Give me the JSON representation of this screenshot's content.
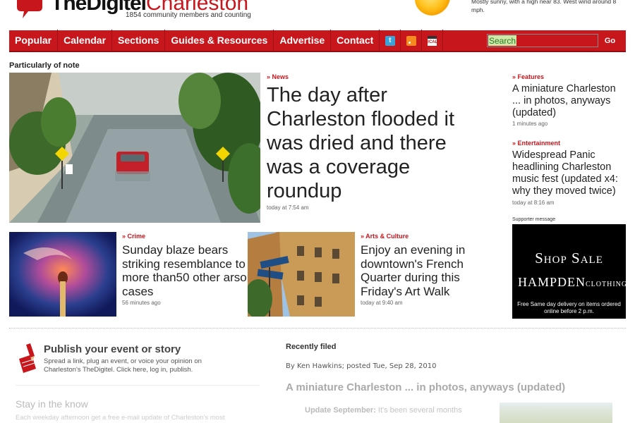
{
  "header": {
    "logo_part1": "TheDigitel",
    "logo_part2": "Charleston",
    "tagline": "1854 community members and counting",
    "weather": "Mostly sunny, with a high near 83. West wind around 8 mph.",
    "accent_color": "#c8161d"
  },
  "nav": {
    "items": [
      "Popular",
      "Calendar",
      "Sections",
      "Guides & Resources",
      "Advertise",
      "Contact"
    ],
    "icons": [
      "twitter-icon",
      "rss-icon",
      "ical-icon"
    ],
    "search_placeholder": "Search",
    "go_label": "Go"
  },
  "section_label": "Particularly of note",
  "main_story": {
    "category": "News",
    "headline": "The day after Charleston flooded it was dried and there was a coverage roundup",
    "time": "today at 7:54 am"
  },
  "stories": [
    {
      "category": "Crime",
      "headline": "Sunday blaze bears striking resemblance to more than50 other arson cases",
      "time": "56 minutes ago"
    },
    {
      "category": "Arts & Culture",
      "headline": "Enjoy an evening in downtown's French Quarter during this Friday's Art Walk",
      "time": "today at 9:40 am"
    }
  ],
  "sidebar": {
    "items": [
      {
        "category": "Features",
        "headline": "A miniature Charleston ... in photos, anyways (updated)",
        "time": "1 minutes ago"
      },
      {
        "category": "Entertainment",
        "headline": "Widespread Panic headlining Charleston music fest (updated x4: why they moved twice)",
        "time": "today at 8:16 am"
      }
    ],
    "supporter_label": "Supporter message",
    "ad": {
      "line1": "Shop Sale",
      "line2": "HAMPDEN",
      "line2_small": "CLOTHING",
      "line3": "Free Same day delivery on items ordered online before 2 p.m."
    }
  },
  "publish": {
    "title": "Publish your event or story",
    "desc": "Spread a link, plug an event, or voice your opinion on Charleston's TheDigitel. Click here, log in, publish."
  },
  "stay": {
    "title": "Stay in the know",
    "desc": "Each weekday afternoon get a free e-mail update of Charleston's most"
  },
  "recent": {
    "label": "Recently filed",
    "byline": "By Ken Hawkins; posted Tue, Sep 28, 2010",
    "title": "A miniature Charleston ... in photos, anyways (updated)",
    "update_label": "Update September:",
    "update_text": " It's been several months"
  }
}
